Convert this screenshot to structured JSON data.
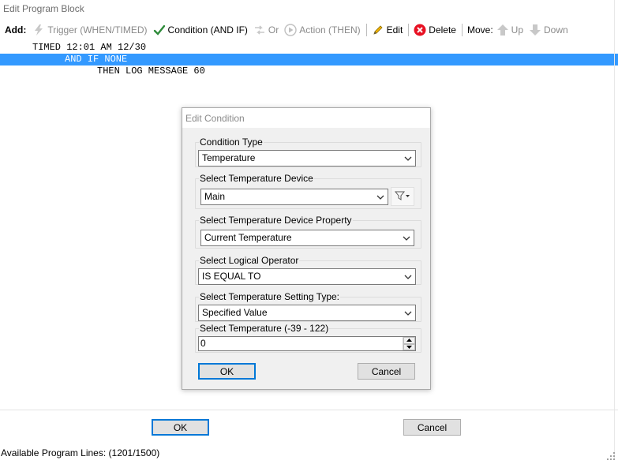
{
  "window": {
    "title": "Edit Program Block"
  },
  "toolbar": {
    "add_label": "Add:",
    "trigger": "Trigger (WHEN/TIMED)",
    "condition": "Condition (AND IF)",
    "or": "Or",
    "action": "Action (THEN)",
    "edit": "Edit",
    "delete": "Delete",
    "move_label": "Move:",
    "up": "Up",
    "down": "Down"
  },
  "program": {
    "lines": [
      "TIMED 12:01 AM 12/30",
      "AND IF NONE",
      "THEN LOG MESSAGE 60"
    ],
    "selected_index": 1
  },
  "dialog": {
    "title": "Edit Condition",
    "condition_type": {
      "label": "Condition Type",
      "value": "Temperature"
    },
    "device": {
      "label": "Select Temperature Device",
      "value": "Main"
    },
    "property": {
      "label": "Select Temperature Device Property",
      "value": "Current Temperature"
    },
    "operator": {
      "label": "Select Logical Operator",
      "value": "IS EQUAL TO"
    },
    "setting_type": {
      "label": "Select Temperature Setting Type:",
      "value": "Specified Value"
    },
    "temperature": {
      "label": "Select Temperature (-39 - 122)",
      "value": "0"
    },
    "ok": "OK",
    "cancel": "Cancel"
  },
  "footer": {
    "ok": "OK",
    "cancel": "Cancel"
  },
  "status": {
    "text": "Available Program Lines: (1201/1500)"
  },
  "colors": {
    "selection": "#3399ff",
    "accent": "#0078d7",
    "delete_red": "#e81123",
    "check_green": "#2e8b3a"
  }
}
